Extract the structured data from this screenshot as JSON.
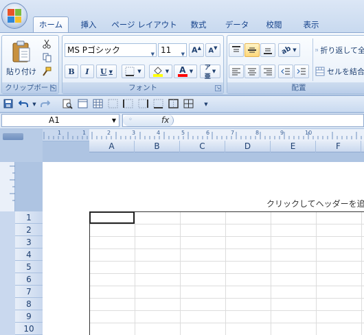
{
  "tabs": [
    {
      "label": "ホーム",
      "active": true
    },
    {
      "label": "挿入",
      "active": false
    },
    {
      "label": "ページ レイアウト",
      "active": false
    },
    {
      "label": "数式",
      "active": false
    },
    {
      "label": "データ",
      "active": false
    },
    {
      "label": "校閲",
      "active": false
    },
    {
      "label": "表示",
      "active": false
    }
  ],
  "clipboard": {
    "group_label": "クリップボード",
    "paste_label": "貼り付け"
  },
  "font": {
    "group_label": "フォント",
    "font_name": "MS Pゴシック",
    "font_size": "11"
  },
  "alignment": {
    "group_label": "配置",
    "wrap_label": "折り返して全",
    "merge_label": "セルを結合"
  },
  "namebox": {
    "value": "A1"
  },
  "formula_bar": {
    "fx_label": "fx",
    "value": ""
  },
  "columns": [
    "A",
    "B",
    "C",
    "D",
    "E",
    "F"
  ],
  "rows": [
    "1",
    "2",
    "3",
    "4",
    "5",
    "6",
    "7",
    "8",
    "9",
    "10"
  ],
  "ruler_numbers": [
    "1",
    "1",
    "2",
    "3",
    "4",
    "5",
    "6",
    "7",
    "8",
    "9",
    "10"
  ],
  "page": {
    "header_hint": "クリックしてヘッダーを追加"
  },
  "colors": {
    "ribbon_bg": "#dae6f4",
    "accent": "#15428b",
    "selected": "#ffd87a",
    "highlight_yellow": "#ffff00",
    "font_red": "#ff0000"
  }
}
